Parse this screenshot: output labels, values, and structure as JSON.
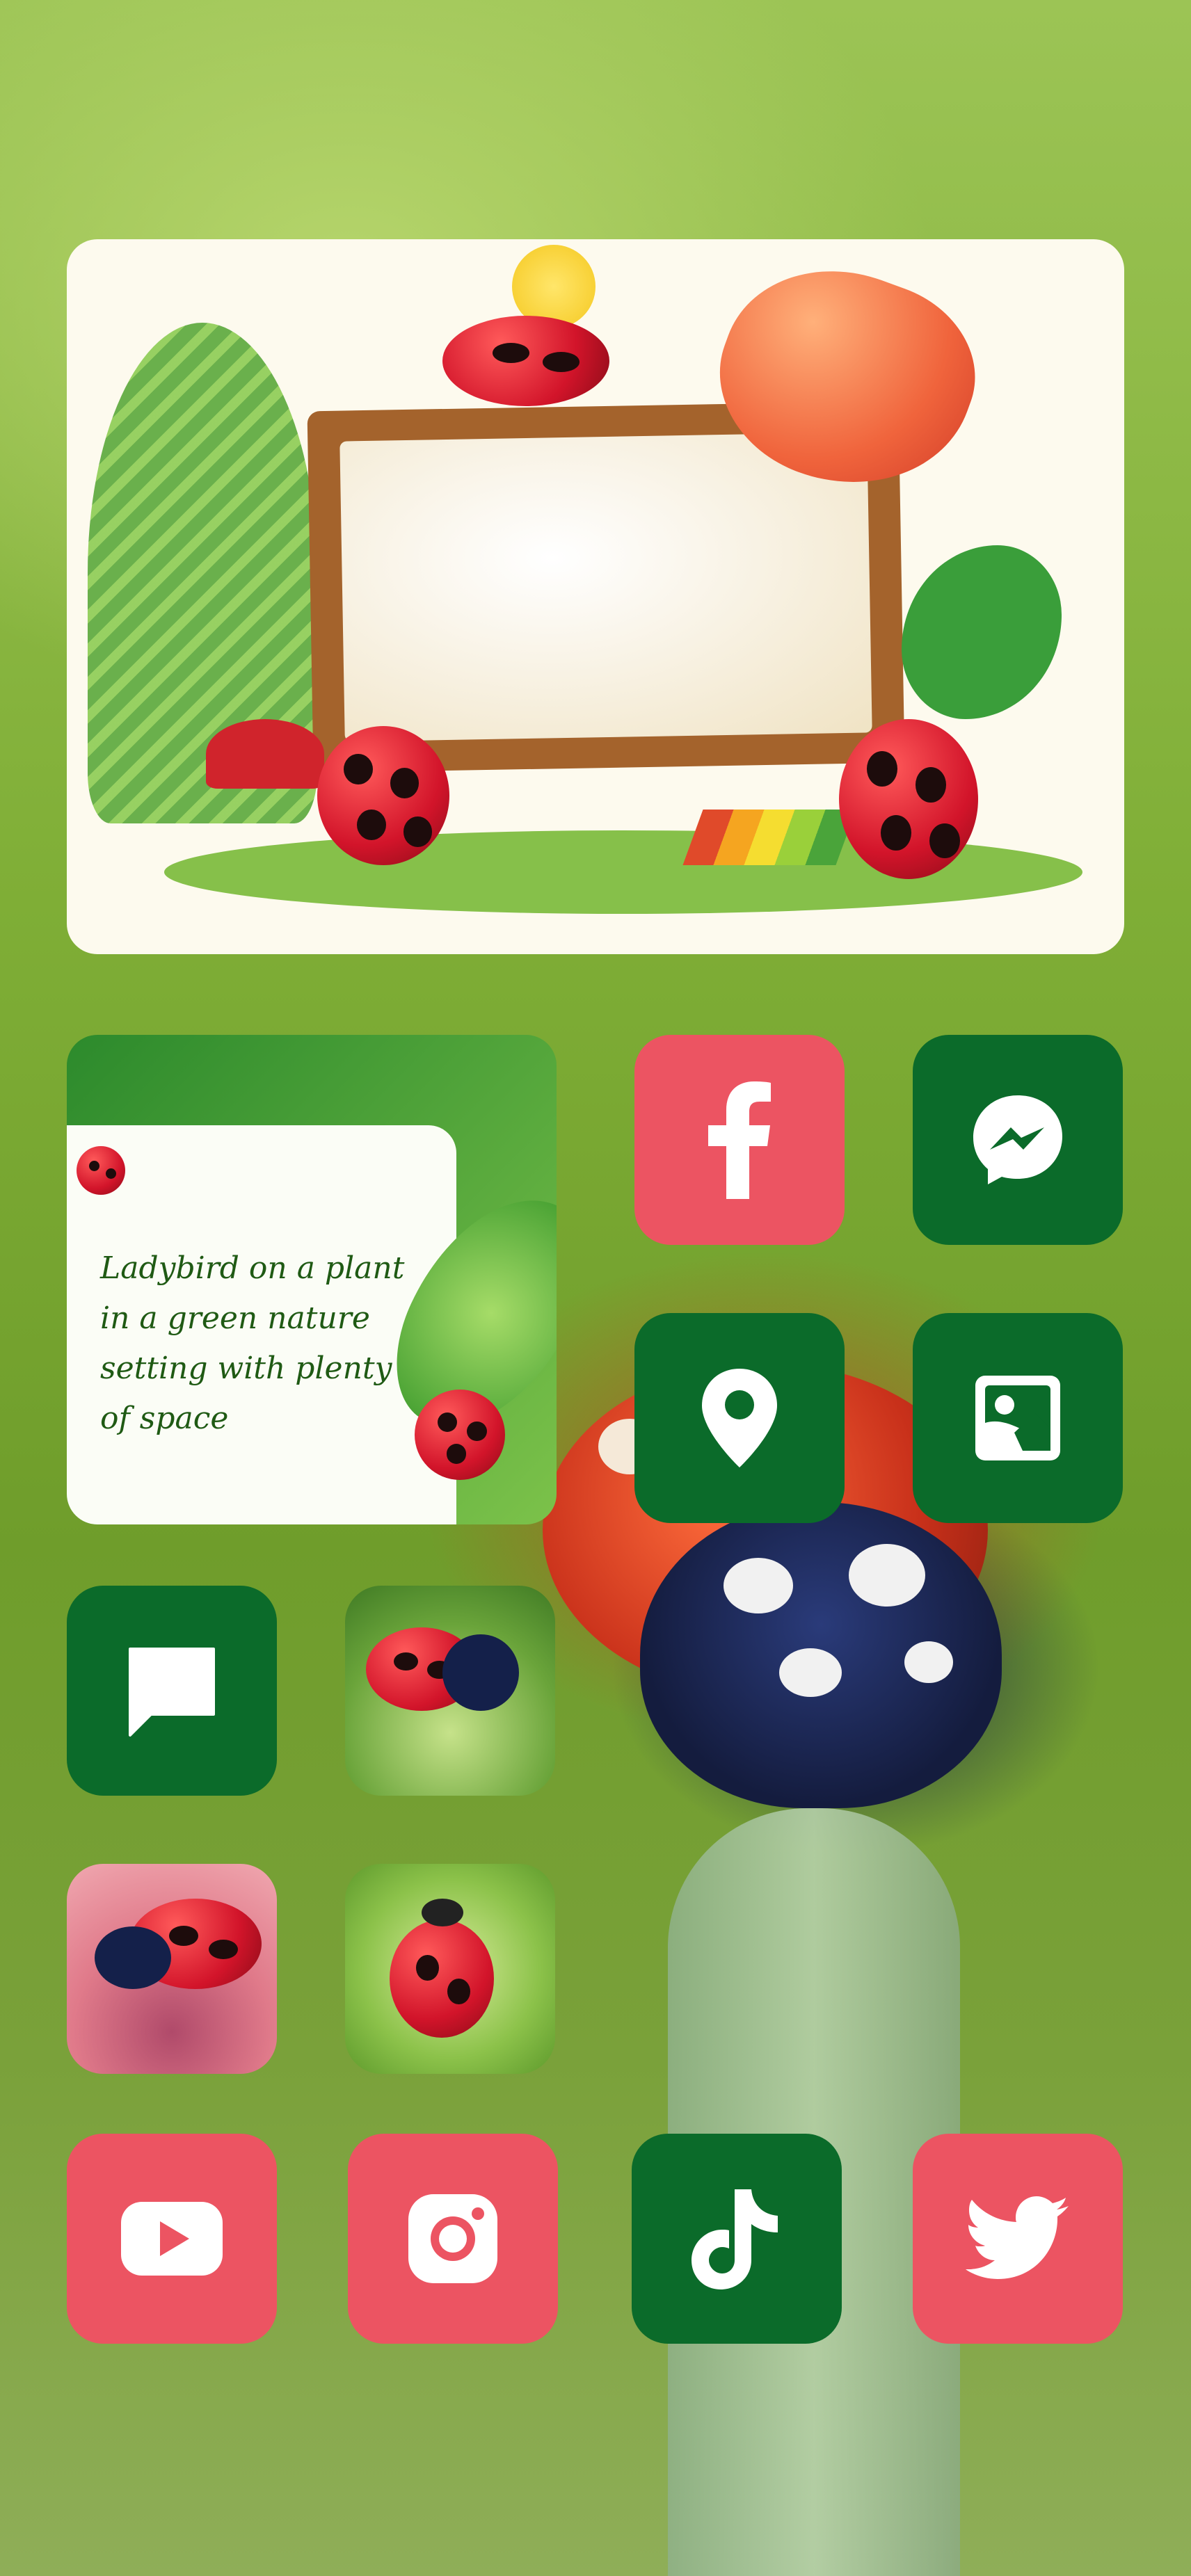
{
  "theme": {
    "accent_red": "#ec5462",
    "accent_green": "#0b6b2a",
    "note_text_color": "#1f5a14"
  },
  "widgets": {
    "banner": {
      "image": "ladybugs-with-wooden-signboard-illustration"
    },
    "note": {
      "text": "Ladybird on a plant in a green nature setting with plenty of space"
    }
  },
  "apps": [
    {
      "name": "facebook",
      "icon": "facebook-icon",
      "color": "red"
    },
    {
      "name": "messenger",
      "icon": "messenger-icon",
      "color": "green"
    },
    {
      "name": "maps",
      "icon": "map-pin-icon",
      "color": "green"
    },
    {
      "name": "photos",
      "icon": "photo-icon",
      "color": "green"
    },
    {
      "name": "messages",
      "icon": "chat-bubble-icon",
      "color": "green"
    },
    {
      "name": "youtube",
      "icon": "play-icon",
      "color": "red"
    },
    {
      "name": "instagram",
      "icon": "instagram-icon",
      "color": "red"
    },
    {
      "name": "tiktok",
      "icon": "tiktok-icon",
      "color": "green"
    },
    {
      "name": "twitter",
      "icon": "twitter-bird-icon",
      "color": "red"
    }
  ],
  "photo_widgets": [
    {
      "image": "ladybug-on-leaf-photo"
    },
    {
      "image": "ladybug-on-pink-flower-photo"
    },
    {
      "image": "ladybug-on-grass-stem-photo"
    }
  ]
}
